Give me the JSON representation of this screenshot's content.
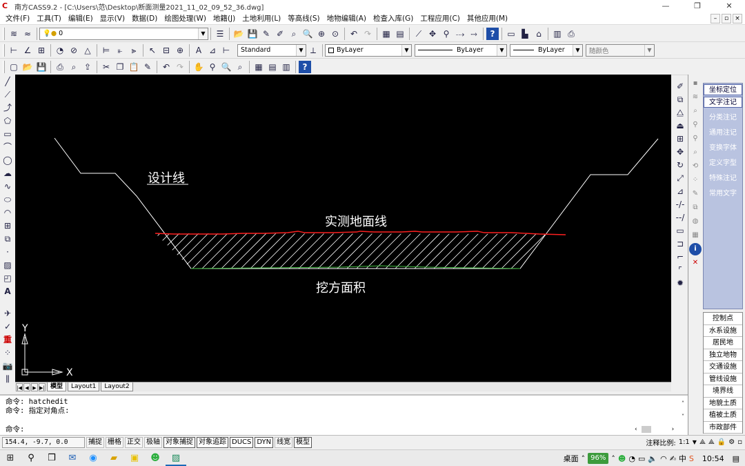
{
  "app": {
    "icon_glyph": "C",
    "title": "南方CASS9.2 - [C:\\Users\\范\\Desktop\\断面测量2021_11_02_09_52_36.dwg]",
    "window_buttons": [
      "—",
      "❐",
      "✕"
    ]
  },
  "menu": {
    "items": [
      "文件(F)",
      "工具(T)",
      "编辑(E)",
      "显示(V)",
      "数据(D)",
      "绘图处理(W)",
      "地籍(J)",
      "土地利用(L)",
      "等高线(S)",
      "地物编辑(A)",
      "检查入库(G)",
      "工程应用(C)",
      "其他应用(M)"
    ],
    "doc_controls": [
      "–",
      "▫",
      "×"
    ]
  },
  "toolbar1": {
    "layer_value": "0"
  },
  "toolbar2": {
    "text_style": "Standard",
    "color": "ByLayer",
    "linetype": "ByLayer",
    "lineweight": "ByLayer",
    "plotstyle": "随颜色"
  },
  "drawing": {
    "labels": {
      "design_line": "设计线",
      "ground_line": "实测地面线",
      "cut_area": "挖方面积",
      "ucs_y": "Y",
      "ucs_x": "X"
    },
    "colors": {
      "background": "#000000",
      "design_line": "#ffffff",
      "ground_line": "#ff2020",
      "hatch": "#ffffff",
      "bottom_line": "#3fbf3f"
    }
  },
  "layout_tabs": [
    "模型",
    "Layout1",
    "Layout2"
  ],
  "right_panel": {
    "top_items": [
      "坐标定位",
      "文字注记",
      "分类注记",
      "通用注记",
      "变换字体",
      "定义字型",
      "特殊注记",
      "常用文字"
    ],
    "bottom_items": [
      "控制点",
      "水系设施",
      "居民地",
      "独立地物",
      "交通设施",
      "管线设施",
      "境界线",
      "地貌土质",
      "植被土质",
      "市政部件"
    ]
  },
  "command": {
    "line1": "命令:  hatchedit",
    "line2": "命令: 指定对角点:",
    "prompt": "命令:"
  },
  "status": {
    "coords": "154.4, -9.7, 0.0",
    "toggles": [
      "捕捉",
      "栅格",
      "正交",
      "极轴",
      "对象捕捉",
      "对象追踪",
      "DUCS",
      "DYN",
      "线宽",
      "模型"
    ],
    "scale_label": "注释比例:",
    "scale_value": "1:1"
  },
  "taskbar": {
    "desktop": "桌面",
    "battery": "96%",
    "time": "10:54"
  }
}
